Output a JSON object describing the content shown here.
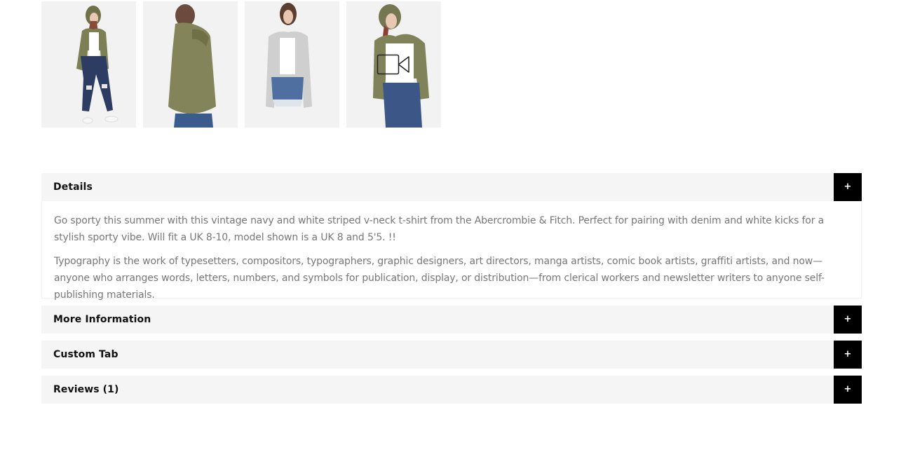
{
  "gallery": {
    "thumbnails": [
      {
        "name": "thumb-front-green-hoodie",
        "alt": "Model in olive hooded jacket, front view"
      },
      {
        "name": "thumb-back-green-hoodie",
        "alt": "Model in olive hooded jacket, back view"
      },
      {
        "name": "thumb-grey-cardigan",
        "alt": "Model in grey cardigan"
      },
      {
        "name": "thumb-video-green-hoodie",
        "alt": "Model in olive hooded jacket, video",
        "icon": "video-camera-icon"
      }
    ]
  },
  "accordion": {
    "toggle_symbol": "+",
    "items": [
      {
        "title": "Details",
        "expanded": true,
        "paragraphs": [
          "Go sporty this summer with this vintage navy and white striped v-neck t-shirt from the Abercrombie & Fitch. Perfect for pairing with denim and white kicks for a stylish sporty vibe. Will fit a UK 8-10, model shown is a UK 8 and 5'5. !!",
          "Typography is the work of typesetters, compositors, typographers, graphic designers, art directors, manga artists, comic book artists, graffiti artists, and now—anyone who arranges words, letters, numbers, and symbols for publication, display, or distribution—from clerical workers and newsletter writers to anyone self-publishing materials."
        ]
      },
      {
        "title": "More Information",
        "expanded": false
      },
      {
        "title": "Custom Tab",
        "expanded": false
      },
      {
        "title": "Reviews (1)",
        "expanded": false
      }
    ]
  },
  "colors": {
    "header_bg": "#f5f5f6",
    "toggle_bg": "#000000",
    "body_text": "#777777",
    "title_text": "#111111"
  }
}
